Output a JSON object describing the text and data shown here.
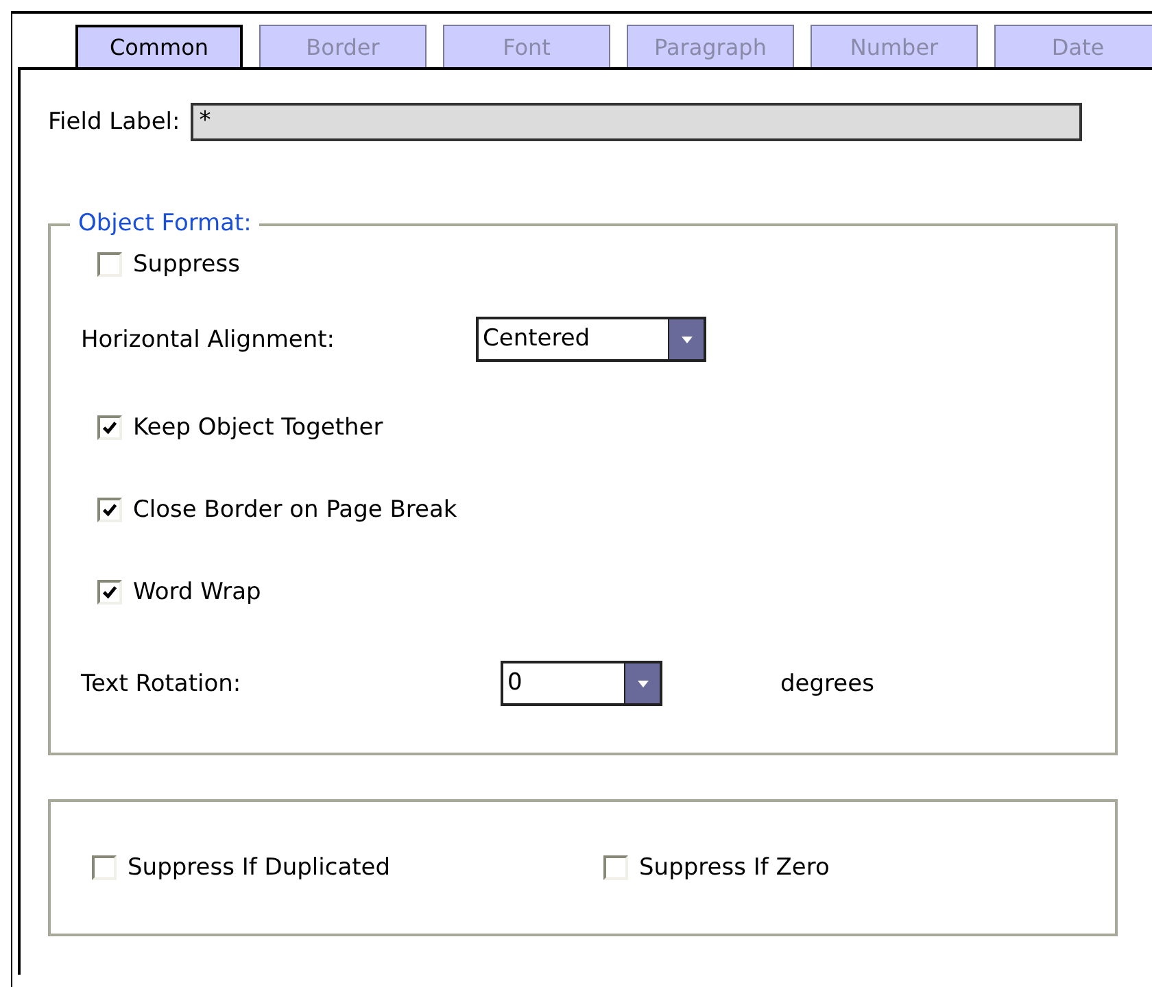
{
  "tabs": [
    {
      "label": "Common",
      "selected": true
    },
    {
      "label": "Border",
      "selected": false
    },
    {
      "label": "Font",
      "selected": false
    },
    {
      "label": "Paragraph",
      "selected": false
    },
    {
      "label": "Number",
      "selected": false
    },
    {
      "label": "Date",
      "selected": false
    }
  ],
  "field_label": {
    "label": "Field Label:",
    "value": "*"
  },
  "object_format": {
    "title": "Object Format:",
    "items": [
      {
        "kind": "checkbox",
        "label": "Suppress",
        "checked": false
      },
      {
        "kind": "select",
        "label": "Horizontal Alignment:",
        "value": "Centered"
      },
      {
        "kind": "checkbox",
        "label": "Keep Object Together",
        "checked": true
      },
      {
        "kind": "checkbox",
        "label": "Close Border on Page Break",
        "checked": true
      },
      {
        "kind": "checkbox",
        "label": "Word Wrap",
        "checked": true
      },
      {
        "kind": "select",
        "label": "Text Rotation:",
        "value": "0",
        "unit": "degrees"
      }
    ]
  },
  "suppress_options": [
    {
      "label": "Suppress If Duplicated",
      "checked": false
    },
    {
      "label": "Suppress If Zero",
      "checked": false
    }
  ]
}
